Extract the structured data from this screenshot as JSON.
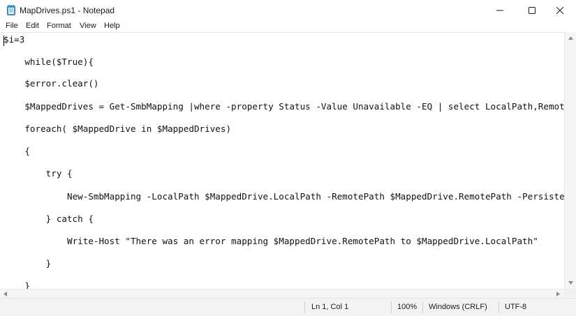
{
  "window": {
    "title": "MapDrives.ps1 - Notepad",
    "icon": "notepad-icon",
    "controls": {
      "minimize_icon": "minimize-icon",
      "maximize_icon": "maximize-icon",
      "close_icon": "close-icon"
    }
  },
  "menu": {
    "items": [
      "File",
      "Edit",
      "Format",
      "View",
      "Help"
    ]
  },
  "editor": {
    "lines": [
      "$i=3",
      "    while($True){",
      "    $error.clear()",
      "    $MappedDrives = Get-SmbMapping |where -property Status -Value Unavailable -EQ | select LocalPath,RemotePath",
      "    foreach( $MappedDrive in $MappedDrives)",
      "    {",
      "        try {",
      "            New-SmbMapping -LocalPath $MappedDrive.LocalPath -RemotePath $MappedDrive.RemotePath -Persistent $True",
      "        } catch {",
      "            Write-Host \"There was an error mapping $MappedDrive.RemotePath to $MappedDrive.LocalPath\"",
      "        }",
      "    }"
    ]
  },
  "statusbar": {
    "position": "Ln 1, Col 1",
    "zoom": "100%",
    "line_ending": "Windows (CRLF)",
    "encoding": "UTF-8"
  }
}
